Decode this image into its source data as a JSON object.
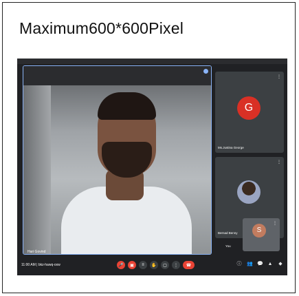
{
  "caption": "Maximum600*600Pixel",
  "main_participant": {
    "name": "Hari Govind"
  },
  "participants": [
    {
      "name": "Ms.Justina George",
      "initial": "G"
    },
    {
      "name": "Bernad Benny"
    },
    {
      "name": "You",
      "initial": "S"
    }
  ],
  "meeting": {
    "info": "11:00 AM  |  bkz-hawq-oxw"
  },
  "controls": {
    "mic": "🎤",
    "cam": "▣",
    "cc": "≡",
    "hand": "✋",
    "present": "▢",
    "more": "⋮",
    "end": "☎"
  },
  "right_icons": [
    "ⓘ",
    "👥",
    "💬",
    "▲",
    "◆"
  ],
  "colors": {
    "accent": "#8ab4f8",
    "danger": "#ea4335",
    "avatar_g": "#d93025"
  }
}
